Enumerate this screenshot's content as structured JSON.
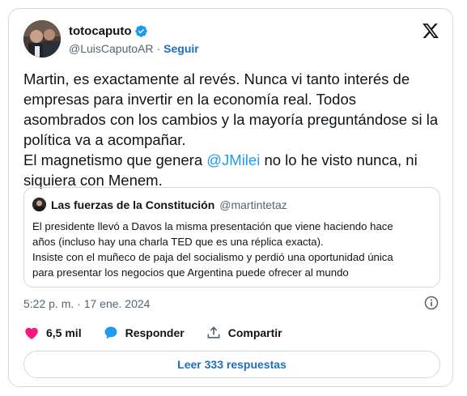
{
  "author": {
    "display_name": "totocaputo",
    "handle": "@LuisCaputoAR",
    "separator": "·",
    "follow_label": "Seguir"
  },
  "tweet": {
    "line1": "Martin, es exactamente al revés. Nunca vi tanto interés de empresas para invertir en la economía real. Todos asombrados con los cambios y la mayoría preguntándose si la política va a acompañar.",
    "line2_before": "El magnetismo que genera ",
    "line2_mention": "@JMilei",
    "line2_after": " no lo he visto nunca, ni siquiera con Menem."
  },
  "quote": {
    "display_name": "Las fuerzas de la Constitución",
    "handle": "@martintetaz",
    "lines": [
      "El presidente llevó a Davos  la misma presentación que viene haciendo hace",
      "años (incluso hay una charla TED que es una réplica exacta).",
      "Insiste con el muñeco de paja del socialismo y perdió una oportunidad única",
      "para presentar los negocios que Argentina puede ofrecer al mundo"
    ]
  },
  "meta": {
    "timestamp": "5:22 p. m. · 17 ene. 2024"
  },
  "actions": {
    "likes": "6,5 mil",
    "reply_label": "Responder",
    "share_label": "Compartir"
  },
  "replies_button": "Leer 333 respuestas",
  "colors": {
    "accent": "#1d9bf0",
    "link_dark": "#1d6ec4",
    "like": "#f91880",
    "text": "#0f1419",
    "muted": "#536471",
    "border": "#cfd9de"
  },
  "icons": [
    "verified-badge-icon",
    "x-logo-icon",
    "info-icon",
    "heart-icon",
    "reply-bubble-icon",
    "share-icon"
  ]
}
